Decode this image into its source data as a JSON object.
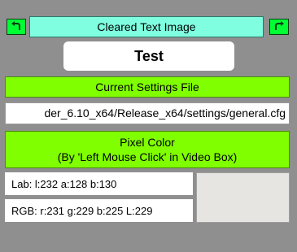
{
  "header": {
    "title": "Cleared Text Image",
    "back_icon": "undo-arrow-icon",
    "forward_icon": "redo-arrow-icon"
  },
  "name_display": "Test",
  "settings": {
    "label": "Current Settings File",
    "path": "der_6.10_x64/Release_x64/settings/general.cfg"
  },
  "pixel_color": {
    "title": "Pixel Color",
    "subtitle": "(By 'Left Mouse Click' in Video Box)",
    "lab": "Lab: l:232 a:128 b:130",
    "rgb": "RGB: r:231 g:229 b:225 L:229",
    "swatch_color": "#e7e5e1"
  },
  "colors": {
    "background": "#8f8f8f",
    "nav_button": "#00ff33",
    "title_bar": "#7fffe0",
    "green_label": "#80ff00"
  }
}
